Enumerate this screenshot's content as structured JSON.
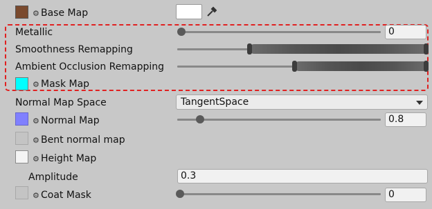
{
  "picker_glyph": "⚙",
  "base_map": {
    "label": "Base Map",
    "thumb_color": "#7a4a2e",
    "swatch_color": "#ffffff",
    "eyedropper_icon": "eyedropper-icon"
  },
  "mask_group": {
    "highlight_color": "#e02020",
    "metallic": {
      "label": "Metallic",
      "value": "0",
      "slider_fraction": 0
    },
    "smoothness": {
      "label": "Smoothness Remapping",
      "range": [
        0.3,
        1.0
      ]
    },
    "ambient_occlusion": {
      "label": "Ambient Occlusion Remapping",
      "range": [
        0.47,
        1.0
      ]
    },
    "mask_map": {
      "label": "Mask Map",
      "thumb_color": "#00ffff"
    }
  },
  "normal_map_space": {
    "label": "Normal Map Space",
    "value": "TangentSpace"
  },
  "normal_map": {
    "label": "Normal Map",
    "thumb_color": "#8080ff",
    "value": "0.8",
    "slider_fraction": 0.16
  },
  "bent_normal_map": {
    "label": "Bent normal map"
  },
  "height_map": {
    "label": "Height Map"
  },
  "amplitude": {
    "label": "Amplitude",
    "value": "0.3"
  },
  "coat_mask": {
    "label": "Coat Mask",
    "value": "0",
    "slider_fraction": 0
  }
}
